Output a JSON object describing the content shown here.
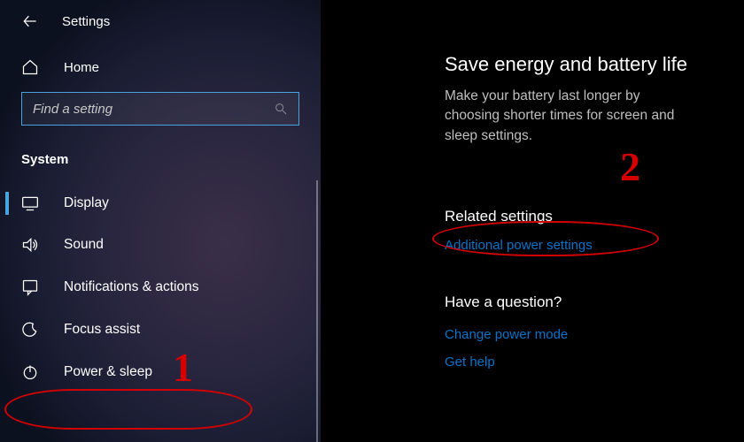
{
  "titlebar": {
    "title": "Settings"
  },
  "home": {
    "label": "Home"
  },
  "search": {
    "placeholder": "Find a setting"
  },
  "category": "System",
  "nav": [
    {
      "icon": "display",
      "label": "Display",
      "active": true
    },
    {
      "icon": "sound",
      "label": "Sound",
      "active": false
    },
    {
      "icon": "notify",
      "label": "Notifications & actions",
      "active": false
    },
    {
      "icon": "focus",
      "label": "Focus assist",
      "active": false
    },
    {
      "icon": "power",
      "label": "Power & sleep",
      "active": false
    }
  ],
  "main": {
    "save_energy_heading": "Save energy and battery life",
    "save_energy_text": "Make your battery last longer by choosing shorter times for screen and sleep settings.",
    "related_heading": "Related settings",
    "related_link": "Additional power settings",
    "question_heading": "Have a question?",
    "question_links": [
      "Change power mode",
      "Get help"
    ]
  },
  "annotations": {
    "one": "1",
    "two": "2"
  }
}
